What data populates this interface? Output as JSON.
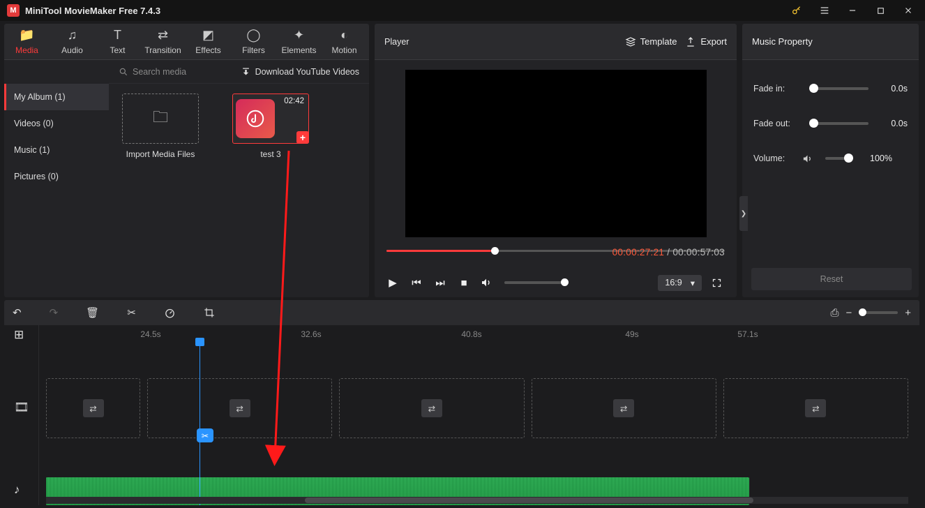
{
  "app": {
    "title": "MiniTool MovieMaker Free 7.4.3"
  },
  "tabs": {
    "media": "Media",
    "audio": "Audio",
    "text": "Text",
    "transition": "Transition",
    "effects": "Effects",
    "filters": "Filters",
    "elements": "Elements",
    "motion": "Motion"
  },
  "library": {
    "categories": {
      "album": "My Album (1)",
      "videos": "Videos (0)",
      "music": "Music (1)",
      "pictures": "Pictures (0)"
    },
    "search_placeholder": "Search media",
    "download_yt": "Download YouTube Videos",
    "import_label": "Import Media Files",
    "clip": {
      "name": "test 3",
      "duration": "02:42"
    }
  },
  "player": {
    "title": "Player",
    "template": "Template",
    "export": "Export",
    "current": "00:00:27:21",
    "sep": " / ",
    "total": "00:00:57:03",
    "ratio": "16:9",
    "progress_pct": 31
  },
  "props": {
    "title": "Music Property",
    "fade_in": {
      "label": "Fade in:",
      "value": "0.0s",
      "pct": 0
    },
    "fade_out": {
      "label": "Fade out:",
      "value": "0.0s",
      "pct": 0
    },
    "volume": {
      "label": "Volume:",
      "value": "100%",
      "pct": 100
    },
    "reset": "Reset"
  },
  "timeline": {
    "marks": [
      "24.5s",
      "32.6s",
      "40.8s",
      "49s",
      "57.1s"
    ]
  }
}
